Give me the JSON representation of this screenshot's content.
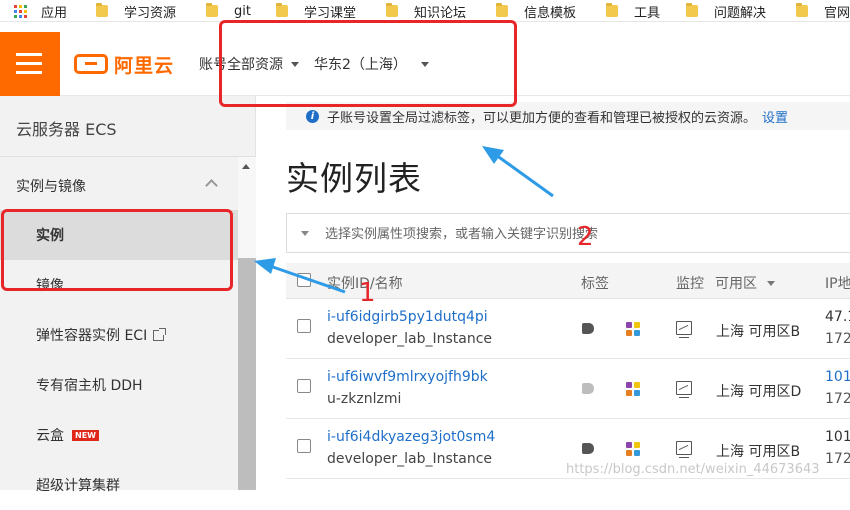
{
  "bookmarks": {
    "apps_label": "应用",
    "items": [
      "学习资源",
      "git",
      "学习课堂",
      "知识论坛",
      "信息模板",
      "工具",
      "问题解决",
      "官网"
    ]
  },
  "topbar": {
    "logo_text": "阿里云",
    "account_resources": "账号全部资源",
    "region": "华东2（上海）"
  },
  "sidebar": {
    "title": "云服务器 ECS",
    "group": "实例与镜像",
    "items": [
      "实例",
      "镜像",
      "弹性容器实例 ECI",
      "专有宿主机 DDH",
      "云盒",
      "超级计算集群"
    ],
    "new_badge": "NEW"
  },
  "notice": {
    "text": "子账号设置全局过滤标签，可以更加方便的查看和管理已被授权的云资源。",
    "link": "设置"
  },
  "page_title": "实例列表",
  "search": {
    "placeholder": "选择实例属性项搜索，或者输入关键字识别搜索"
  },
  "table": {
    "headers": {
      "id_name": "实例ID/名称",
      "tags": "标签",
      "monitor": "监控",
      "zone": "可用区",
      "ip": "IP地"
    },
    "rows": [
      {
        "id": "i-uf6idgirb5py1dutq4pi",
        "name": "developer_lab_Instance",
        "zone": "上海 可用区B",
        "ip1": "47.1",
        "ip2": "172",
        "tag_color": "#555555"
      },
      {
        "id": "i-uf6iwvf9mlrxyojfh9bk",
        "name": "u-zkznlzmi",
        "zone": "上海 可用区D",
        "ip1": "101",
        "ip2": "172",
        "tag_color": "#bdbdbd"
      },
      {
        "id": "i-uf6i4dkyazeg3jot0sm4",
        "name": "developer_lab_Instance",
        "zone": "上海 可用区B",
        "ip1": "101",
        "ip2": "172",
        "tag_color": "#555555"
      }
    ]
  },
  "annotations": {
    "label_1": "1",
    "label_2": "2"
  },
  "watermark": "https://blog.csdn.net/weixin_44673643",
  "colors": {
    "brand": "#ff6a00",
    "link": "#1f6fc9",
    "annotation_red": "#e8262a",
    "annotation_arrow": "#2d9be6"
  }
}
